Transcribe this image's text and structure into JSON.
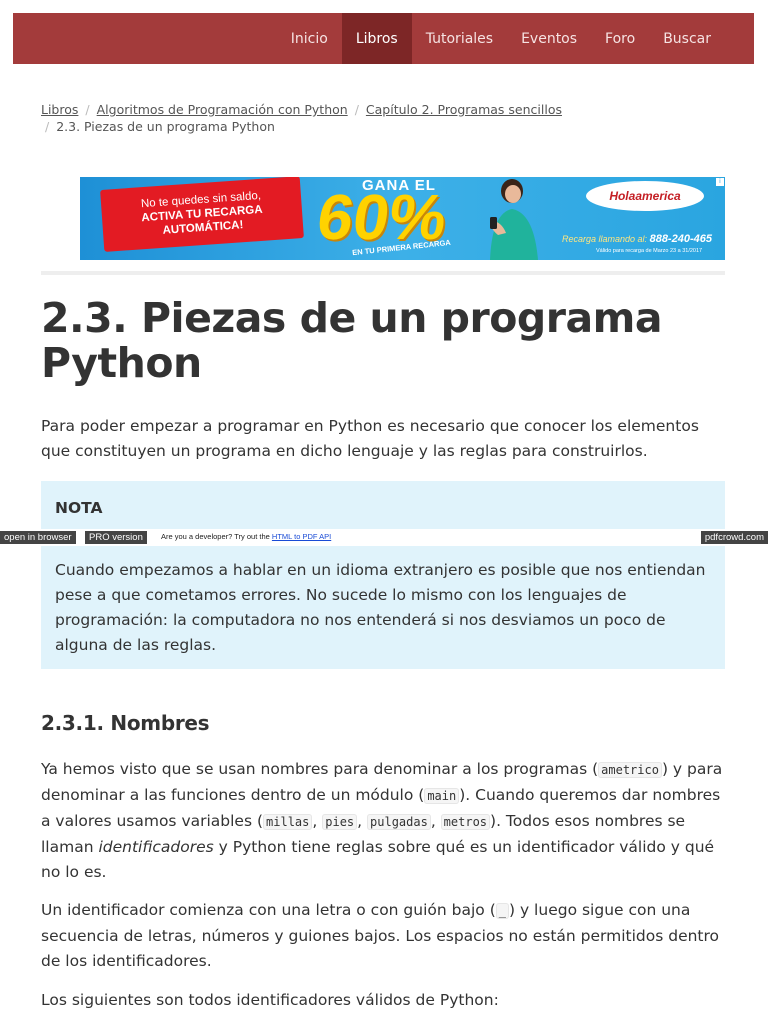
{
  "nav": {
    "items": [
      {
        "label": "Inicio",
        "active": false
      },
      {
        "label": "Libros",
        "active": true
      },
      {
        "label": "Tutoriales",
        "active": false
      },
      {
        "label": "Eventos",
        "active": false
      },
      {
        "label": "Foro",
        "active": false
      },
      {
        "label": "Buscar",
        "active": false
      }
    ],
    "bar_color": "#a33b3b",
    "active_color": "#7d2626"
  },
  "breadcrumb": {
    "items": [
      "Libros",
      "Algoritmos de Programación con Python",
      "Capítulo 2. Programas sencillos"
    ],
    "current": "2.3. Piezas de un programa Python",
    "separator": "/"
  },
  "ad": {
    "tag_line1": "No te quedes sin saldo,",
    "tag_line2": "ACTIVA TU RECARGA",
    "tag_line3": "AUTOMÁTICA!",
    "gana": "GANA EL",
    "percent": "60%",
    "primera": "EN TU PRIMERA RECARGA",
    "logo": "Holaamerica",
    "recarga_label": "Recarga llamando al:",
    "phone": "888-240-465",
    "valido": "Válido para recarga de Marzo 23 a 31/2017"
  },
  "article": {
    "title": "2.3. Piezas de un programa Python",
    "intro": "Para poder empezar a programar en Python es necesario que conocer los elementos que constituyen un programa en dicho lenguaje y las reglas para construirlos.",
    "note_title": "NOTA",
    "note_body": "Cuando empezamos a hablar en un idioma extranjero es posible que nos entiendan pese a que cometamos errores. No sucede lo mismo con los lenguajes de programación: la computadora no nos entenderá si nos desviamos un poco de alguna de las reglas.",
    "section_title": "2.3.1. Nombres",
    "p1": {
      "t1": "Ya hemos visto que se usan nombres para denominar a los programas (",
      "c1": "ametrico",
      "t2": ") y para denominar a las funciones dentro de un módulo (",
      "c2": "main",
      "t3": "). Cuando queremos dar nombres a valores usamos variables (",
      "c3": "millas",
      "s1": ", ",
      "c4": "pies",
      "s2": ", ",
      "c5": "pulgadas",
      "s3": ", ",
      "c6": "metros",
      "t4": "). Todos esos nombres se llaman ",
      "em": "identificadores",
      "t5": " y Python tiene reglas sobre qué es un identificador válido y qué no lo es."
    },
    "p2": {
      "t1": "Un identificador comienza con una letra o con guión bajo (",
      "c1": "_",
      "t2": ") y luego sigue con una secuencia de letras, números y guiones bajos. Los espacios no están permitidos dentro de los identificadores."
    },
    "p3": "Los siguientes son todos identificadores válidos de Python:"
  },
  "pdfcrowd": {
    "open_in_browser": "open in browser",
    "pro_version": "PRO version",
    "message": "Are you a developer? Try out the ",
    "link": "HTML to PDF API",
    "site": "pdfcrowd.com"
  }
}
